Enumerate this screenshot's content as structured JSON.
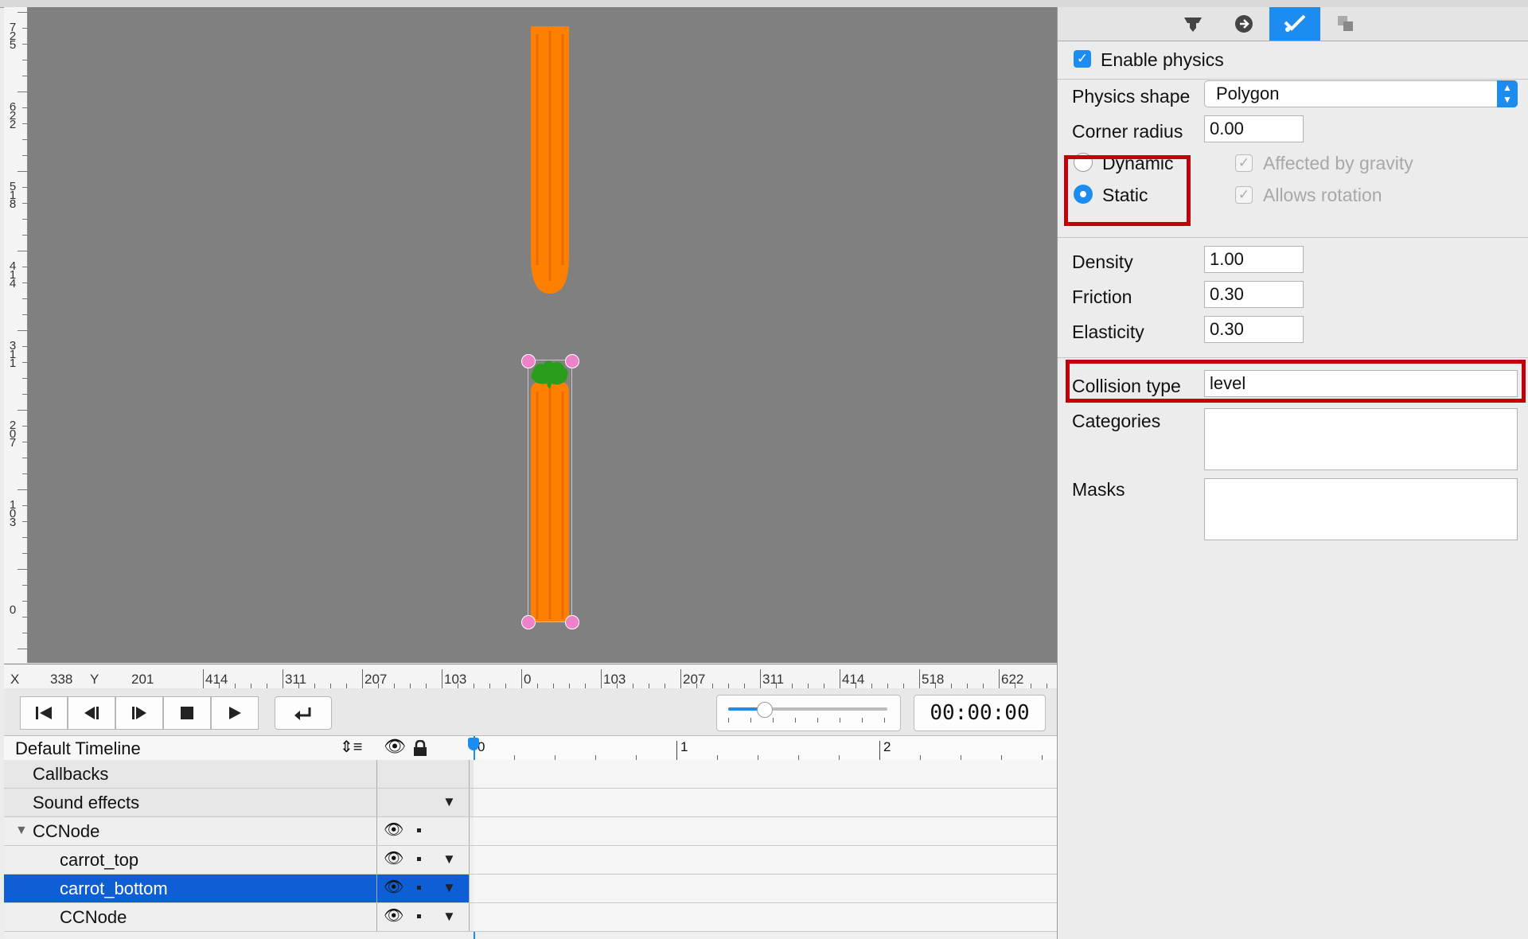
{
  "ruler": {
    "vertical_labels": [
      "725",
      "622",
      "518",
      "414",
      "311",
      "207",
      "103",
      "0"
    ],
    "horizontal_labels": [
      "414",
      "311",
      "207",
      "103",
      "0",
      "103",
      "207",
      "311",
      "414",
      "518",
      "622"
    ],
    "x_label": "X",
    "x_value": "338",
    "y_label": "Y",
    "y_value": "201"
  },
  "playback": {
    "buttons": [
      "skip-to-start",
      "step-back",
      "step-forward",
      "stop",
      "play",
      "loop"
    ],
    "time": "00:00:00"
  },
  "timeline": {
    "name": "Default Timeline",
    "ruler_marks": [
      "0",
      "1",
      "2"
    ],
    "rows": [
      {
        "label": "Callbacks"
      },
      {
        "label": "Sound effects"
      },
      {
        "label": "CCNode"
      },
      {
        "label": "carrot_top"
      },
      {
        "label": "carrot_bottom"
      },
      {
        "label": "CCNode"
      }
    ]
  },
  "inspector": {
    "tabs": [
      "node-properties",
      "code-connections",
      "physics",
      "templates"
    ],
    "enable_physics_label": "Enable physics",
    "physics_shape_label": "Physics shape",
    "physics_shape_value": "Polygon",
    "corner_radius_label": "Corner radius",
    "corner_radius_value": "0.00",
    "dynamic_label": "Dynamic",
    "static_label": "Static",
    "affected_by_gravity_label": "Affected by gravity",
    "allows_rotation_label": "Allows rotation",
    "density_label": "Density",
    "density_value": "1.00",
    "friction_label": "Friction",
    "friction_value": "0.30",
    "elasticity_label": "Elasticity",
    "elasticity_value": "0.30",
    "collision_type_label": "Collision type",
    "collision_type_value": "level",
    "categories_label": "Categories",
    "masks_label": "Masks"
  },
  "colors": {
    "canvas_bg": "#808080",
    "carrot": "#ff7f00",
    "carrot_leaves": "#2a9d1a",
    "selection": "#0e5fd6",
    "accent": "#1c8cf0",
    "highlight_box": "#c30009"
  }
}
